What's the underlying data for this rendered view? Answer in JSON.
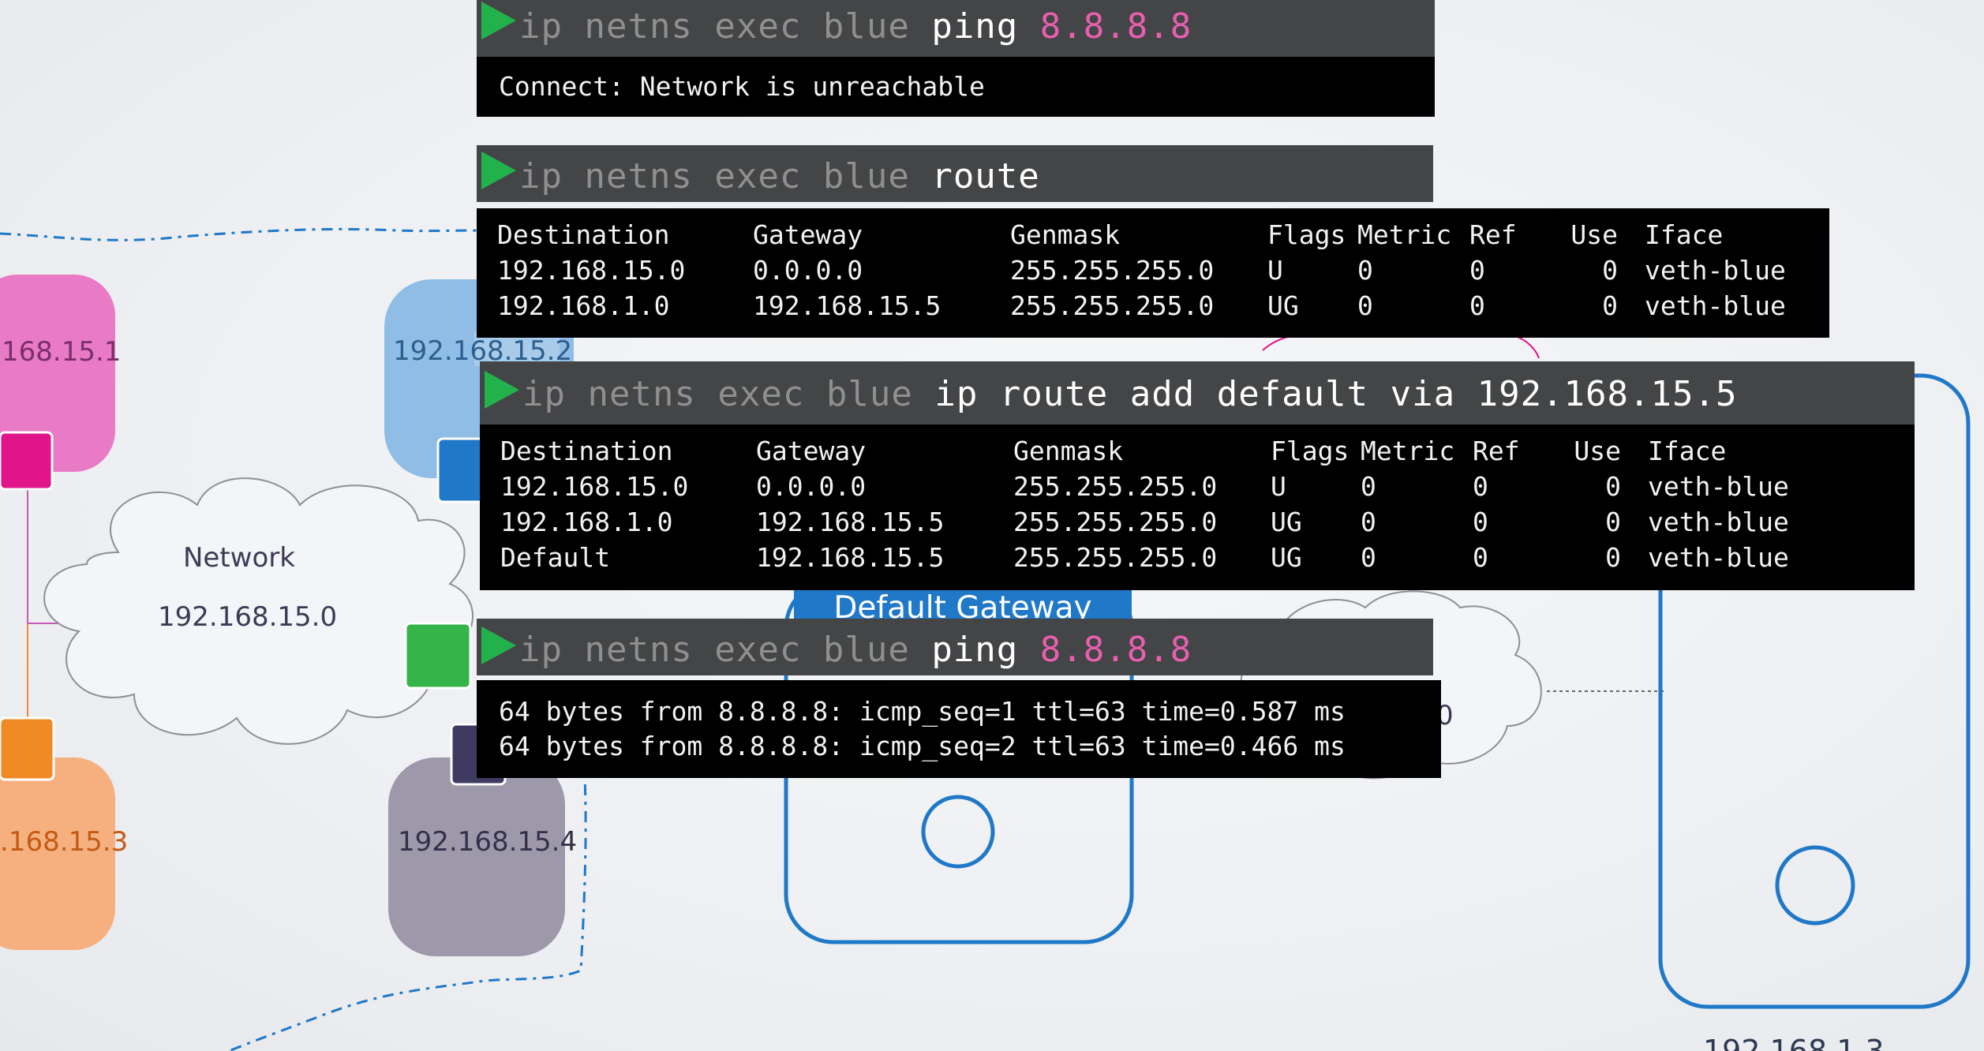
{
  "diagram": {
    "nodes": [
      {
        "ip": "168.15.1",
        "color": "#e87ac6"
      },
      {
        "ip": "192.168.15.2",
        "color": "#8fbde6"
      },
      {
        "ip": ".168.15.3",
        "color": "#f6b07f"
      },
      {
        "ip": "192.168.15.4",
        "color": "#9d99ab"
      }
    ],
    "cloud": {
      "title": "Network",
      "subnet": "192.168.15.0"
    },
    "gateway_label": "Default Gateway",
    "partial_cloud_text": "0",
    "bottom_partial_ip": "192.168.1.3",
    "line_color": "#1f78c8"
  },
  "terminals": [
    {
      "cmd": [
        {
          "t": "ip netns exec blue ",
          "s": "dim"
        },
        {
          "t": "ping ",
          "s": "hl"
        },
        {
          "t": "8.8.8.8",
          "s": "pink"
        }
      ],
      "output": [
        "Connect: Network is unreachable"
      ]
    },
    {
      "cmd": [
        {
          "t": "ip netns exec blue ",
          "s": "dim"
        },
        {
          "t": "route",
          "s": "hl"
        }
      ],
      "table": {
        "headers": [
          "Destination",
          "Gateway",
          "Genmask",
          "Flags",
          "Metric",
          "Ref",
          "Use",
          "Iface"
        ],
        "rows": [
          [
            "192.168.15.0",
            "0.0.0.0",
            "255.255.255.0",
            "U",
            "0",
            "0",
            "0",
            "veth-blue"
          ],
          [
            "192.168.1.0",
            "192.168.15.5",
            "255.255.255.0",
            "UG",
            "0",
            "0",
            "0",
            "veth-blue"
          ]
        ]
      }
    },
    {
      "cmd": [
        {
          "t": "ip netns exec blue ",
          "s": "dim"
        },
        {
          "t": "ip route add default via 192.168.15.5",
          "s": "hl"
        }
      ],
      "table": {
        "headers": [
          "Destination",
          "Gateway",
          "Genmask",
          "Flags",
          "Metric",
          "Ref",
          "Use",
          "Iface"
        ],
        "rows": [
          [
            "192.168.15.0",
            "0.0.0.0",
            "255.255.255.0",
            "U",
            "0",
            "0",
            "0",
            "veth-blue"
          ],
          [
            "192.168.1.0",
            "192.168.15.5",
            "255.255.255.0",
            "UG",
            "0",
            "0",
            "0",
            "veth-blue"
          ],
          [
            "Default",
            "192.168.15.5",
            "255.255.255.0",
            "UG",
            "0",
            "0",
            "0",
            "veth-blue"
          ]
        ]
      }
    },
    {
      "cmd": [
        {
          "t": "ip netns exec blue ",
          "s": "dim"
        },
        {
          "t": "ping ",
          "s": "hl"
        },
        {
          "t": "8.8.8.8",
          "s": "pink"
        }
      ],
      "output": [
        "64 bytes from 8.8.8.8: icmp_seq=1 ttl=63 time=0.587 ms",
        "64 bytes from 8.8.8.8: icmp_seq=2 ttl=63 time=0.466 ms"
      ]
    }
  ]
}
